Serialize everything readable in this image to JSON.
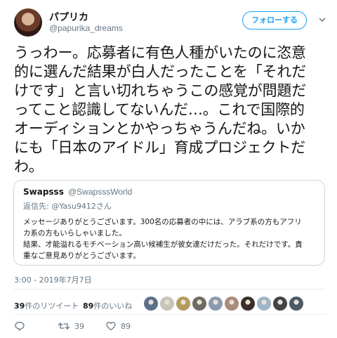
{
  "author": {
    "display_name": "パプリカ",
    "handle": "@papurika_dreams",
    "follow_label": "フォローする"
  },
  "tweet": {
    "lines": [
      "うっわー。応募者に有色人種がいたのに恣意",
      "的に選んだ結果が白人だったことを「それだ",
      "けです」と言い切れちゃうこの感覚が問題だ",
      "ってこと認識してないんだ…。これで国際的",
      "オーディションとかやっちゃうんだね。いか",
      "にも「日本のアイドル」育成プロジェクトだ",
      "わ。"
    ]
  },
  "quote": {
    "name": "Swapsss",
    "handle": "@SwapsssWorld",
    "reply_to": "返信先: @Yasu9412さん",
    "lines": [
      "メッセージありがとうございます。300名の応募者の中には、アラブ系の方もアフリ",
      "カ系の方もいらしゃいました。",
      "結果、才能溢れるモチベーション高い候補生が彼女達だけだった。それだけです。貴",
      "重なご意見ありがとうございます。"
    ]
  },
  "timestamp": "3:00 - 2019年7月7日",
  "stats": {
    "retweet_count": "39",
    "retweet_label": "件のリツイート",
    "like_count": "89",
    "like_label": "件のいいね"
  },
  "likers": [
    {
      "name": "liker-avatar-1",
      "color": "#5b6f8a"
    },
    {
      "name": "liker-avatar-2",
      "color": "#c9c4b8"
    },
    {
      "name": "liker-avatar-3",
      "color": "#b49a5c"
    },
    {
      "name": "liker-avatar-4",
      "color": "#6f6a62"
    },
    {
      "name": "liker-avatar-5",
      "color": "#8a9bb0"
    },
    {
      "name": "liker-avatar-6",
      "color": "#a88b7a"
    },
    {
      "name": "liker-avatar-7",
      "color": "#3a2e2a"
    },
    {
      "name": "liker-avatar-8",
      "color": "#9fb6c9"
    },
    {
      "name": "liker-avatar-9",
      "color": "#444444"
    },
    {
      "name": "liker-avatar-10",
      "color": "#4d5a66"
    }
  ],
  "actions": {
    "retweet_count": "39",
    "like_count": "89"
  },
  "colors": {
    "accent": "#1da1f2",
    "secondary_text": "#657786",
    "border": "#ccd6dd"
  }
}
